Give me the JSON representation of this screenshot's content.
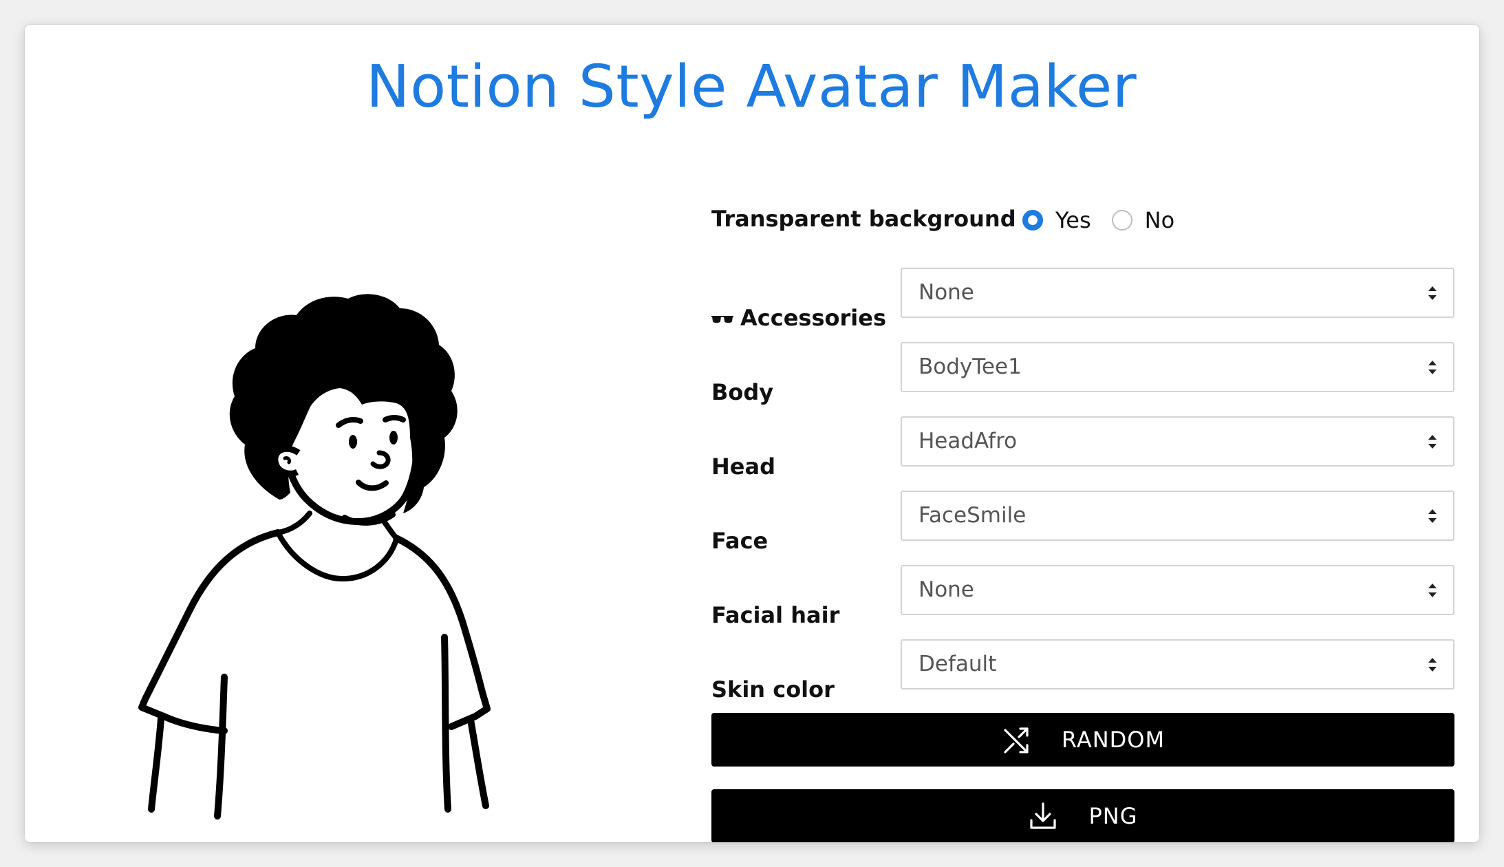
{
  "app": {
    "title": "Notion Style Avatar Maker"
  },
  "form": {
    "transparent_background": {
      "label": "Transparent background",
      "options": [
        {
          "label": "Yes",
          "checked": true
        },
        {
          "label": "No",
          "checked": false
        }
      ]
    },
    "fields": [
      {
        "label": "Accessories",
        "value": "None",
        "icon": "sunglasses-icon"
      },
      {
        "label": "Body",
        "value": "BodyTee1"
      },
      {
        "label": "Head",
        "value": "HeadAfro"
      },
      {
        "label": "Face",
        "value": "FaceSmile"
      },
      {
        "label": "Facial hair",
        "value": "None"
      },
      {
        "label": "Skin color",
        "value": "Default"
      }
    ]
  },
  "buttons": {
    "random": {
      "label": "RANDOM",
      "icon": "shuffle-icon"
    },
    "png": {
      "label": "PNG",
      "icon": "download-icon"
    }
  },
  "colors": {
    "accent": "#1e7be0",
    "button_bg": "#000000",
    "button_text": "#ffffff"
  }
}
